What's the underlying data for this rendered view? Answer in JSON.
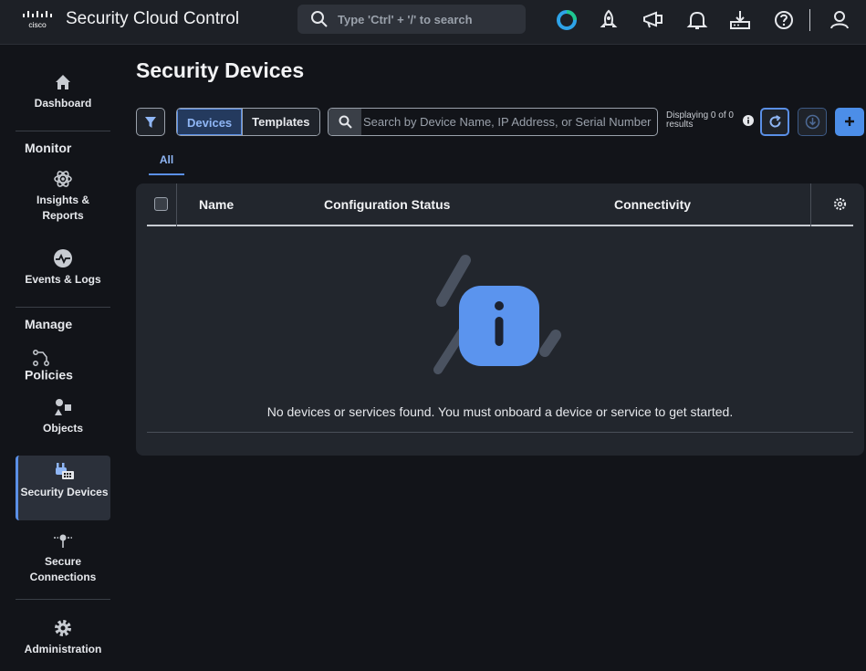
{
  "header": {
    "brand": "cisco",
    "app_title": "Security Cloud Control",
    "search_placeholder": "Type 'Ctrl' + '/' to search",
    "icons": [
      "webex-icon",
      "rocket-icon",
      "megaphone-icon",
      "bell-icon",
      "download-icon",
      "help-icon",
      "user-icon"
    ]
  },
  "sidebar": {
    "dashboard": "Dashboard",
    "monitor_label": "Monitor",
    "insights": "Insights & Reports",
    "events": "Events & Logs",
    "manage_label": "Manage",
    "policies": "Policies",
    "objects": "Objects",
    "security_devices": "Security Devices",
    "secure_connections": "Secure Connections",
    "administration": "Administration"
  },
  "main": {
    "title": "Security Devices",
    "segment": [
      "Devices",
      "Templates"
    ],
    "search_placeholder": "Search by Device Name, IP Address, or Serial Number",
    "displaying": "Displaying 0 of 0 results",
    "tab_all": "All",
    "table": {
      "columns": [
        "Name",
        "Configuration Status",
        "Connectivity"
      ],
      "empty_message": "No devices or services found. You must onboard a device or service to get started."
    }
  },
  "colors": {
    "accent": "#5a8fe6",
    "primary_button": "#4c8ee8",
    "background": "#121419",
    "card": "#22262d"
  }
}
